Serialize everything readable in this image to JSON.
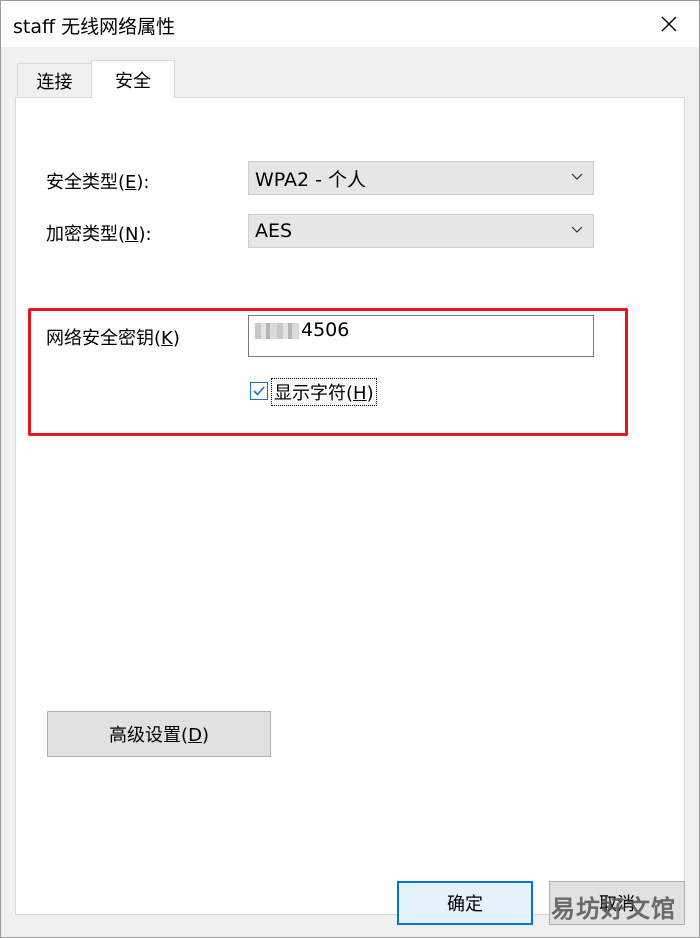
{
  "window": {
    "title": "staff 无线网络属性"
  },
  "tabs": [
    {
      "label": "连接"
    },
    {
      "label": "安全"
    }
  ],
  "security": {
    "security_type": {
      "label_prefix": "安全类型(",
      "label_key": "E",
      "label_suffix": "):",
      "value": "WPA2 - 个人"
    },
    "encryption_type": {
      "label_prefix": "加密类型(",
      "label_key": "N",
      "label_suffix": "):",
      "value": "AES"
    },
    "network_key": {
      "label_prefix": "网络安全密钥(",
      "label_key": "K",
      "label_suffix": ")",
      "visible_value": "4506"
    },
    "show_chars": {
      "label_prefix": "显示字符(",
      "label_key": "H",
      "label_suffix": ")",
      "checked": true
    }
  },
  "advanced_button": {
    "label_prefix": "高级设置(",
    "label_key": "D",
    "label_suffix": ")"
  },
  "footer": {
    "ok_label": "确定",
    "cancel_label": "取消"
  },
  "watermark": {
    "text": "易坊好文馆"
  },
  "colors": {
    "highlight": "#e8161b",
    "accent": "#0078d7"
  }
}
